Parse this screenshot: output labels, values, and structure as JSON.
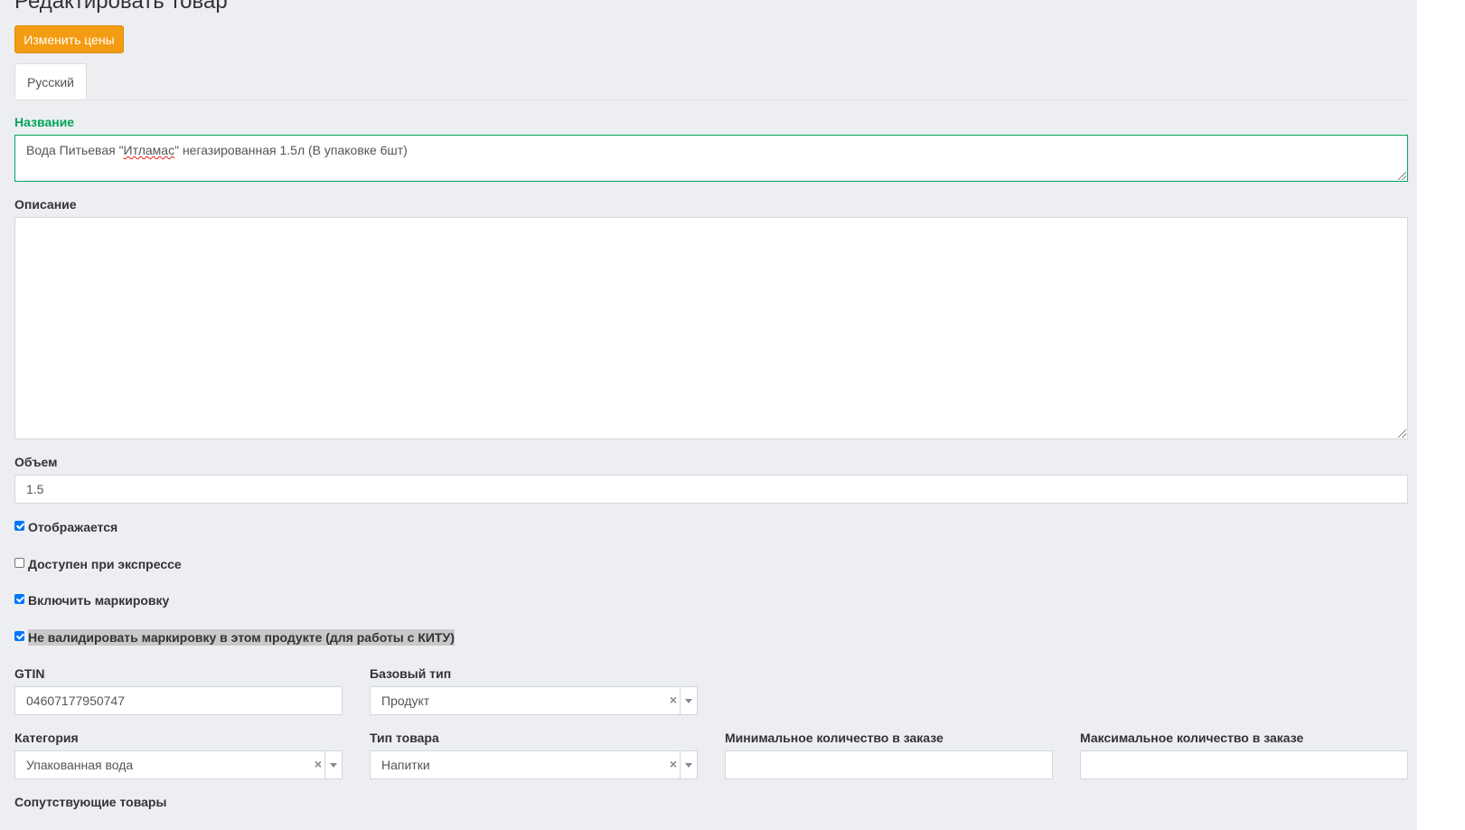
{
  "page": {
    "title": "Редактировать товар"
  },
  "actions": {
    "change_prices_label": "Изменить цены"
  },
  "tabs": [
    {
      "label": "Русский",
      "active": true
    }
  ],
  "form": {
    "name": {
      "label": "Название",
      "value_before": "Вода Питьевая \"",
      "value_misspelled": "Итламас",
      "value_after": "\" негазированная 1.5л (В упаковке 6шт)"
    },
    "description": {
      "label": "Описание",
      "value": ""
    },
    "volume": {
      "label": "Объем",
      "value": "1.5"
    },
    "checkboxes": [
      {
        "label": "Отображается",
        "checked": true
      },
      {
        "label": "Доступен при экспрессе",
        "checked": false
      },
      {
        "label": "Включить маркировку",
        "checked": true
      },
      {
        "label": "Не валидировать маркировку в этом продукте (для работы с КИТУ)",
        "checked": true
      }
    ],
    "gtin": {
      "label": "GTIN",
      "value": "04607177950747"
    },
    "base_type": {
      "label": "Базовый тип",
      "value": "Продукт",
      "clear_glyph": "×"
    },
    "category": {
      "label": "Категория",
      "value": "Упакованная вода",
      "clear_glyph": "×"
    },
    "product_type": {
      "label": "Тип товара",
      "value": "Напитки",
      "clear_glyph": "×"
    },
    "min_order_qty": {
      "label": "Минимальное количество в заказе",
      "value": ""
    },
    "max_order_qty": {
      "label": "Максимальное количество в заказе",
      "value": ""
    },
    "related_products": {
      "label": "Сопутствующие товары"
    }
  },
  "colors": {
    "background": "#eceef2",
    "accent_orange": "#f39c12",
    "success_green": "#00a65a",
    "checkbox_blue": "#0075ff"
  }
}
